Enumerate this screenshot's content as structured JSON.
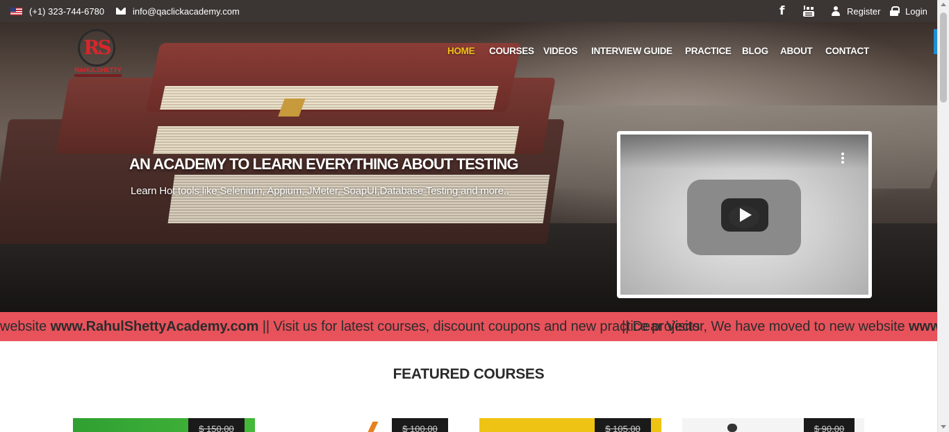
{
  "topbar": {
    "phone": "(+1) 323-744-6780",
    "email": "info@qaclickacademy.com",
    "register": "Register",
    "login": "Login"
  },
  "logo": {
    "name": "RAHULSHETTY",
    "monogram": "RS"
  },
  "nav": {
    "items": [
      "HOME",
      "COURSES",
      "VIDEOS",
      "INTERVIEW GUIDE",
      "PRACTICE",
      "BLOG",
      "ABOUT",
      "CONTACT"
    ],
    "active": "HOME",
    "active_color": "#f2c11b"
  },
  "hero": {
    "headline": "AN ACADEMY TO LEARN EVERYTHING ABOUT TESTING",
    "subline": "Learn Hot tools like Selenium, Appium, JMeter, SoapUI,Database Testing and more.."
  },
  "marquee": {
    "part1_prefix": "website ",
    "part1_site": "www.RahulShettyAcademy.com",
    "part1_suffix": " || Visit us for latest courses, discount coupons and new practice projects",
    "part2_prefix": "|| Dear Visitor, We have moved to new website ",
    "part2_site": "www",
    "background": "#e8525b"
  },
  "featured": {
    "title": "FEATURED COURSES"
  },
  "courses": [
    {
      "price": "$ 150.00"
    },
    {
      "price": "$ 100.00"
    },
    {
      "price": "$ 105.00"
    },
    {
      "price": "$ 90.00"
    }
  ]
}
